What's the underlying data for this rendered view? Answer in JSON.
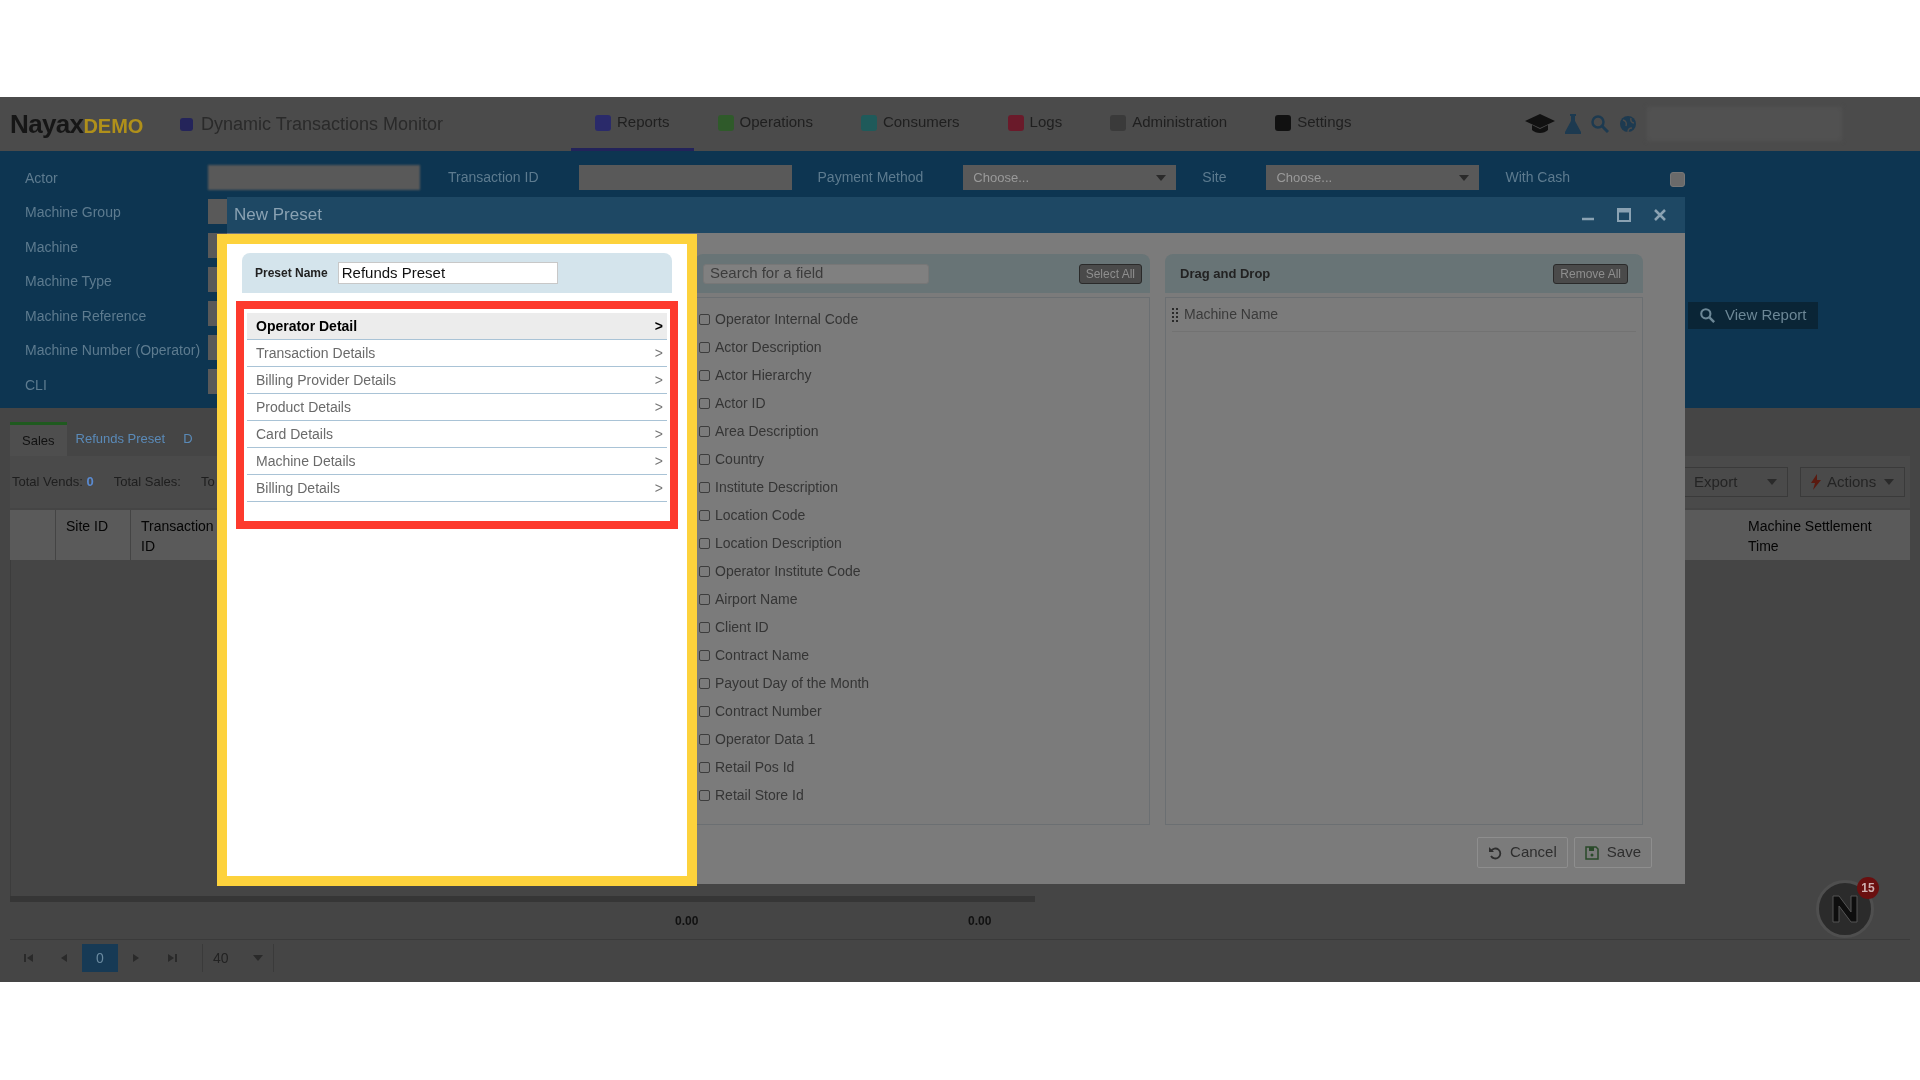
{
  "header": {
    "logo_main": "Nayax",
    "logo_sub": "DEMO",
    "app_title": "Dynamic Transactions Monitor",
    "nav": [
      {
        "label": "Reports",
        "selected": true,
        "color": "#2a2a6a"
      },
      {
        "label": "Operations",
        "selected": false,
        "color": "#2f5a2a"
      },
      {
        "label": "Consumers",
        "selected": false,
        "color": "#1f5a5a"
      },
      {
        "label": "Logs",
        "selected": false,
        "color": "#6a1a2a"
      },
      {
        "label": "Administration",
        "selected": false,
        "color": "#3a3a3a"
      },
      {
        "label": "Settings",
        "selected": false,
        "color": "#111111"
      }
    ]
  },
  "filters": {
    "left": [
      "Actor",
      "Machine Group",
      "Machine",
      "Machine Type",
      "Machine Reference",
      "Machine Number (Operator)",
      "CLI"
    ],
    "top_fields": [
      {
        "label": "Transaction ID",
        "kind": "input"
      },
      {
        "label": "Payment Method",
        "kind": "select",
        "placeholder": "Choose..."
      },
      {
        "label": "Site",
        "kind": "select",
        "placeholder": "Choose..."
      },
      {
        "label": "With Cash",
        "kind": "checkbox",
        "checked": false
      }
    ],
    "view_report": "View Report"
  },
  "report_tabs": [
    {
      "label": "Sales",
      "selected": true
    },
    {
      "label": "Refunds Preset",
      "selected": false
    },
    {
      "label": "D",
      "selected": false
    }
  ],
  "totals": [
    {
      "label": "Total Vends:",
      "value": "0"
    },
    {
      "label": "Total Sales:"
    },
    {
      "label": "To"
    }
  ],
  "toolbar": [
    "Export",
    "Actions"
  ],
  "table": {
    "columns_left": [
      "Site ID",
      "Transaction ID"
    ],
    "columns_right": [
      "Machine Settlement Time"
    ],
    "footer": [
      "0.00",
      "0.00"
    ]
  },
  "pager": {
    "page": "0",
    "page_size": "40"
  },
  "notification_badge": "15",
  "dialog": {
    "title": "New Preset",
    "preset_name_label": "Preset Name",
    "preset_name": "Refunds Preset",
    "categories": [
      {
        "label": "Operator Detail",
        "selected": true,
        "chevron": ">"
      },
      {
        "label": "Transaction Details",
        "selected": false,
        "chevron": ">"
      },
      {
        "label": "Billing Provider Details",
        "selected": false,
        "chevron": ">"
      },
      {
        "label": "Product Details",
        "selected": false,
        "chevron": ">"
      },
      {
        "label": "Card Details",
        "selected": false,
        "chevron": ">"
      },
      {
        "label": "Machine Details",
        "selected": false,
        "chevron": ">"
      },
      {
        "label": "Billing Details",
        "selected": false,
        "chevron": ">"
      }
    ],
    "search_placeholder": "Search for a field",
    "select_all": "Select All",
    "fields": [
      {
        "label": "Operator Internal Code",
        "checked": false
      },
      {
        "label": "Actor Description",
        "checked": false
      },
      {
        "label": "Actor Hierarchy",
        "checked": false
      },
      {
        "label": "Actor ID",
        "checked": false
      },
      {
        "label": "Area Description",
        "checked": false
      },
      {
        "label": "Country",
        "checked": false
      },
      {
        "label": "Institute Description",
        "checked": false
      },
      {
        "label": "Location Code",
        "checked": false
      },
      {
        "label": "Location Description",
        "checked": false
      },
      {
        "label": "Operator Institute Code",
        "checked": false
      },
      {
        "label": "Airport Name",
        "checked": false
      },
      {
        "label": "Client ID",
        "checked": false
      },
      {
        "label": "Contract Name",
        "checked": false
      },
      {
        "label": "Payout Day of the Month",
        "checked": false
      },
      {
        "label": "Contract Number",
        "checked": false
      },
      {
        "label": "Operator Data 1",
        "checked": false
      },
      {
        "label": "Retail Pos Id",
        "checked": false
      },
      {
        "label": "Retail Store Id",
        "checked": false
      }
    ],
    "drop_title": "Drag and Drop",
    "remove_all": "Remove All",
    "dropped": [
      "Machine Name"
    ],
    "buttons": [
      {
        "label": "Cancel",
        "kind": "cancel"
      },
      {
        "label": "Save",
        "kind": "save"
      }
    ]
  }
}
